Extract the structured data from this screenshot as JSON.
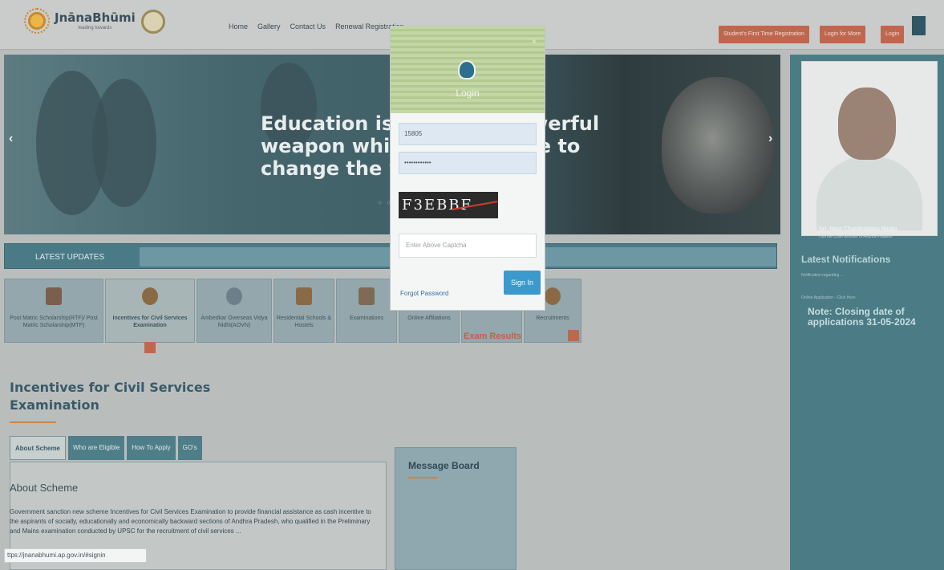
{
  "header": {
    "logo_text": "JnānaBhūmi",
    "logo_tagline": "leading towards",
    "nav": [
      "Home",
      "Gallery",
      "Contact Us",
      "Renewal Registration"
    ],
    "buttons": {
      "registration": "Student's First Time Registration",
      "login_for_more": "Login for More",
      "login": "Login"
    }
  },
  "slider": {
    "quote_line1": "Education is the most powerful",
    "quote_line2": "weapon which you can use to",
    "quote_line3": "change the world",
    "prev": "‹",
    "next": "›",
    "dots": "○ ○ ○"
  },
  "sidebar": {
    "person_name": "Sri. Nara Chandrababu Naidu",
    "person_title": "Hon'ble Chief Minister of Andhra Pradesh",
    "latest_notifications": "Latest Notifications",
    "small_note_1": "Notification regarding ...",
    "small_note_2": "Online Application - Click Here",
    "notice": "Note: Closing date of applications 31-05-2024"
  },
  "latest_updates": {
    "label": "LATEST UPDATES"
  },
  "tiles": [
    {
      "label": "Post Matric Scholarship(RTF)/ Post Matric Scholarship(MTF)"
    },
    {
      "label": "Incentives for Civil Services Examination"
    },
    {
      "label": "Ambedkar Overseas Vidya Nidhi(AOVN)"
    },
    {
      "label": "Residential Schools & Hostels"
    },
    {
      "label": "Examinations"
    },
    {
      "label": "Online Affiliations"
    },
    {
      "label": "Exam Results"
    },
    {
      "label": "Recruitments"
    }
  ],
  "main": {
    "heading": "Incentives for Civil Services Examination",
    "tabs": [
      "About Scheme",
      "Who are Eligible",
      "How To Apply",
      "GO's"
    ],
    "content_title": "About Scheme",
    "content_text": "Government sanction new scheme Incentives for Civil Services Examination to provide financial assistance as cash incentive to the aspirants of socially, educationally and economically backward sections of Andhra Pradesh, who qualified in the Preliminary and Mains examination conducted by UPSC for the recruitment of civil services ..."
  },
  "message_board": {
    "title": "Message Board"
  },
  "status_bar": {
    "url": "ttps://jnanabhumi.ap.gov.in/#signin"
  },
  "login_modal": {
    "title": "Login",
    "close": "×",
    "username_value": "15805",
    "password_value": "••••••••••••",
    "captcha_text": "F3EBBF",
    "captcha_placeholder": "Enter Above Captcha",
    "forgot_password": "Forgot Password",
    "sign_in": "Sign In"
  },
  "colors": {
    "accent_orange": "#c0664f",
    "teal": "#4b7c85",
    "signin_blue": "#3b9acb"
  }
}
